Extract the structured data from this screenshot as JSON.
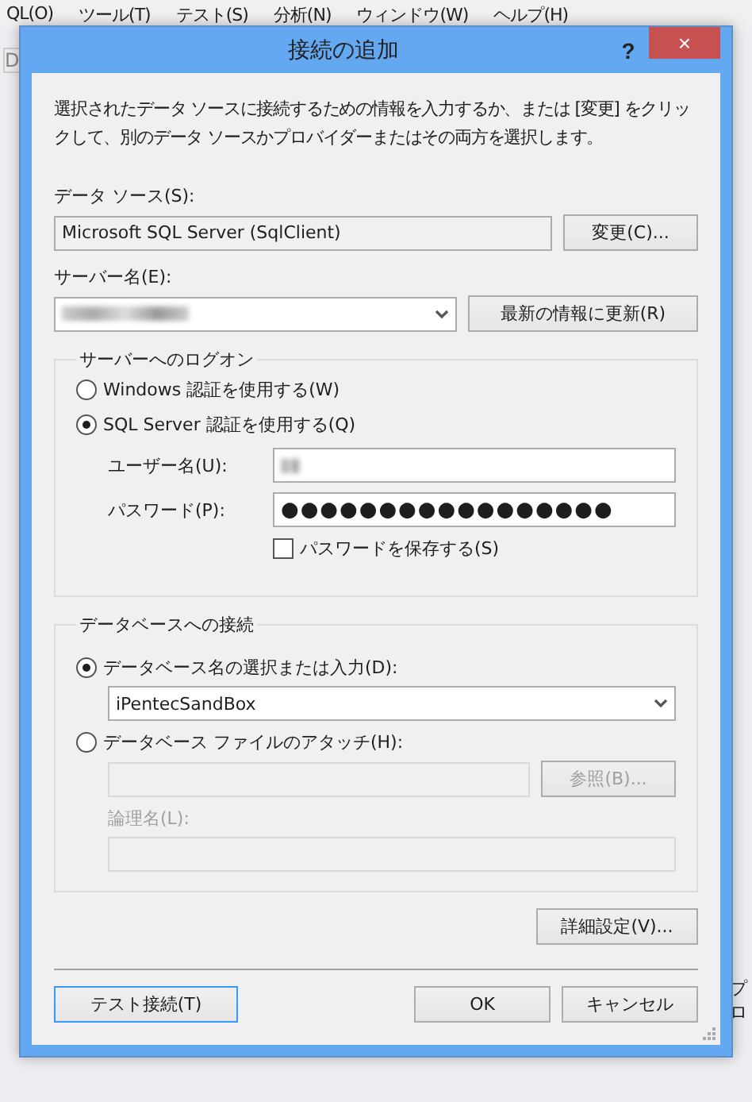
{
  "background_menu": [
    "QL(O)",
    "ツール(T)",
    "テスト(S)",
    "分析(N)",
    "ウィンドウ(W)",
    "ヘルプ(H)"
  ],
  "background_toolbar_text": "D",
  "background_side_text": "プロ",
  "window": {
    "title": "接続の追加",
    "help": "?",
    "close": "×"
  },
  "description": "選択されたデータ ソースに接続するための情報を入力するか、または [変更] をクリックして、別のデータ ソースかプロバイダーまたはその両方を選択します。",
  "data_source": {
    "label": "データ ソース(S):",
    "value": "Microsoft SQL Server (SqlClient)",
    "button": "変更(C)..."
  },
  "server": {
    "label": "サーバー名(E):",
    "redacted": true,
    "button": "最新の情報に更新(R)"
  },
  "logon": {
    "title": "サーバーへのログオン",
    "auth": [
      {
        "label": "Windows 認証を使用する(W)",
        "selected": false
      },
      {
        "label": "SQL Server 認証を使用する(Q)",
        "selected": true
      }
    ],
    "user": {
      "label": "ユーザー名(U):",
      "redacted": true
    },
    "password": {
      "label": "パスワード(P):",
      "value": "●●●●●●●●●●●●●●●●●"
    },
    "save_password": {
      "label": "パスワードを保存する(S)",
      "checked": false
    }
  },
  "database": {
    "title": "データベースへの接続",
    "options": [
      {
        "label": "データベース名の選択または入力(D):",
        "selected": true,
        "kind": "combo",
        "value": "iPentecSandBox"
      },
      {
        "label": "データベース ファイルのアタッチ(H):",
        "selected": false,
        "kind": "file",
        "button": "参照(B)...",
        "logical_label": "論理名(L):"
      }
    ]
  },
  "advanced": "詳細設定(V)...",
  "buttons": [
    {
      "label": "テスト接続(T)",
      "kind": "test",
      "focused": true
    },
    {
      "label": "OK",
      "kind": "ok",
      "focused": false
    },
    {
      "label": "キャンセル",
      "kind": "cancel",
      "focused": false
    }
  ]
}
